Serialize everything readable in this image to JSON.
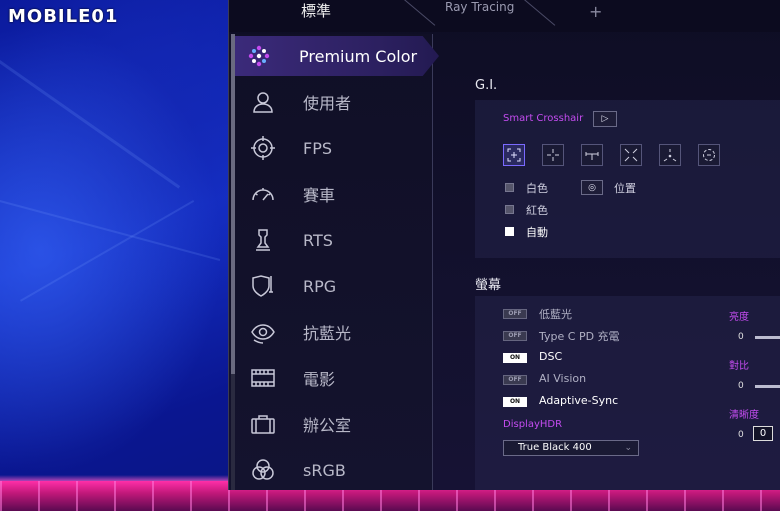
{
  "logo": "MOBILE01",
  "tabs": {
    "standard": "標準",
    "raytracing": "Ray Tracing",
    "add": "+"
  },
  "sidebar": {
    "items": [
      {
        "label": "Premium Color",
        "icon": "premium-color-icon"
      },
      {
        "label": "使用者",
        "icon": "user-icon"
      },
      {
        "label": "FPS",
        "icon": "crosshair-icon"
      },
      {
        "label": "賽車",
        "icon": "speedometer-icon"
      },
      {
        "label": "RTS",
        "icon": "chess-piece-icon"
      },
      {
        "label": "RPG",
        "icon": "shield-sword-icon"
      },
      {
        "label": "抗藍光",
        "icon": "eye-icon"
      },
      {
        "label": "電影",
        "icon": "film-icon"
      },
      {
        "label": "辦公室",
        "icon": "briefcase-icon"
      },
      {
        "label": "sRGB",
        "icon": "rgb-circles-icon"
      }
    ]
  },
  "gi": {
    "title": "G.I.",
    "crosshair_label": "Smart Crosshair",
    "play_glyph": "▷",
    "colors": {
      "white": "白色",
      "red": "紅色",
      "auto": "自動"
    },
    "position_label": "位置"
  },
  "screen": {
    "title": "螢幕",
    "toggles": [
      {
        "state": "OFF",
        "label": "低藍光"
      },
      {
        "state": "OFF",
        "label": "Type C PD 充電"
      },
      {
        "state": "ON",
        "label": "DSC"
      },
      {
        "state": "OFF",
        "label": "AI Vision"
      },
      {
        "state": "ON",
        "label": "Adaptive-Sync"
      }
    ],
    "hdr_label": "DisplayHDR",
    "hdr_value": "True Black 400",
    "brightness_label": "亮度",
    "brightness_value": "0",
    "contrast_label": "對比",
    "contrast_value": "0",
    "sharpness_label": "清晰度",
    "sharpness_value": "0",
    "sharpness_box": "0"
  },
  "colors": {
    "accent": "#c44cf0",
    "active_bg": "#3b2a7a",
    "floor": "#ff2fa8"
  }
}
